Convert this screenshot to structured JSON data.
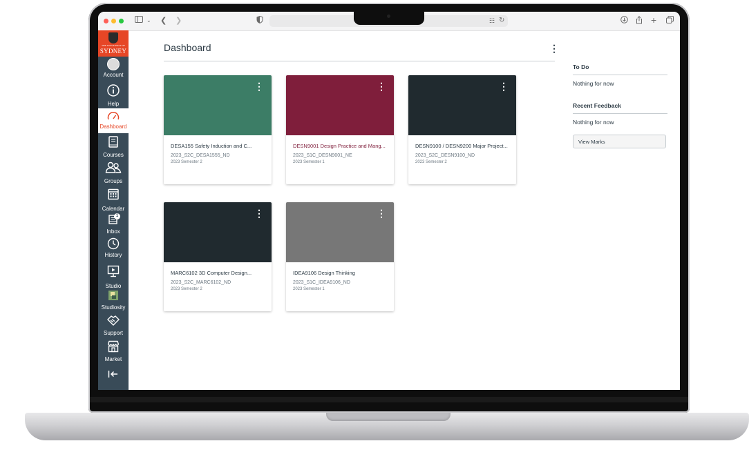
{
  "sidebar": {
    "logo": {
      "small_text": "THE UNIVERSITY OF",
      "name": "SYDNEY"
    },
    "items": [
      {
        "label": "Account",
        "icon": "user-avatar-icon"
      },
      {
        "label": "Help",
        "icon": "info-icon"
      },
      {
        "label": "Dashboard",
        "icon": "speedometer-icon"
      },
      {
        "label": "Courses",
        "icon": "book-icon"
      },
      {
        "label": "Groups",
        "icon": "people-icon"
      },
      {
        "label": "Calendar",
        "icon": "calendar-icon"
      },
      {
        "label": "Inbox",
        "icon": "inbox-icon",
        "badge": "1"
      },
      {
        "label": "History",
        "icon": "clock-icon"
      },
      {
        "label": "Studio",
        "icon": "studio-icon"
      },
      {
        "label": "Studiosity",
        "icon": "studiosity-icon"
      },
      {
        "label": "Support",
        "icon": "handshake-icon"
      },
      {
        "label": "Market",
        "icon": "store-icon"
      }
    ],
    "collapse_icon": "collapse-arrow-icon",
    "active": "Dashboard"
  },
  "header": {
    "title": "Dashboard",
    "options_icon": "kebab-icon"
  },
  "courses": [
    {
      "title": "DESA155 Safety Induction and C...",
      "code": "2023_S2C_DESA1555_ND",
      "term": "2023 Semester 2",
      "color": "#3c7d66",
      "title_color": "#2d3b45"
    },
    {
      "title": "DESN9001 Design Practice and Mang...",
      "code": "2023_S1C_DESN9001_NE",
      "term": "2023 Semester 1",
      "color": "#7f1e3b",
      "title_color": "#7f1e3b"
    },
    {
      "title": "DESN9100 / DESN9200 Major Project...",
      "code": "2023_S2C_DESN9100_ND",
      "term": "2023 Semester 2",
      "color": "#202a2f",
      "title_color": "#2d3b45"
    },
    {
      "title": "MARC6102 3D Computer Design...",
      "code": "2023_S2C_MARC6102_ND",
      "term": "2023 Semester 2",
      "color": "#202a2f",
      "title_color": "#2d3b45"
    },
    {
      "title": "IDEA9106 Design Thinking",
      "code": "2023_S1C_IDEA9106_ND",
      "term": "2023 Semester 1",
      "color": "#777777",
      "title_color": "#2d3b45"
    }
  ],
  "right_panel": {
    "todo_heading": "To Do",
    "todo_text": "Nothing for now",
    "feedback_heading": "Recent Feedback",
    "feedback_text": "Nothing for now",
    "view_marks_label": "View Marks"
  },
  "colors": {
    "brand": "#e64626",
    "nav": "#394b58",
    "text": "#2d3b45"
  }
}
